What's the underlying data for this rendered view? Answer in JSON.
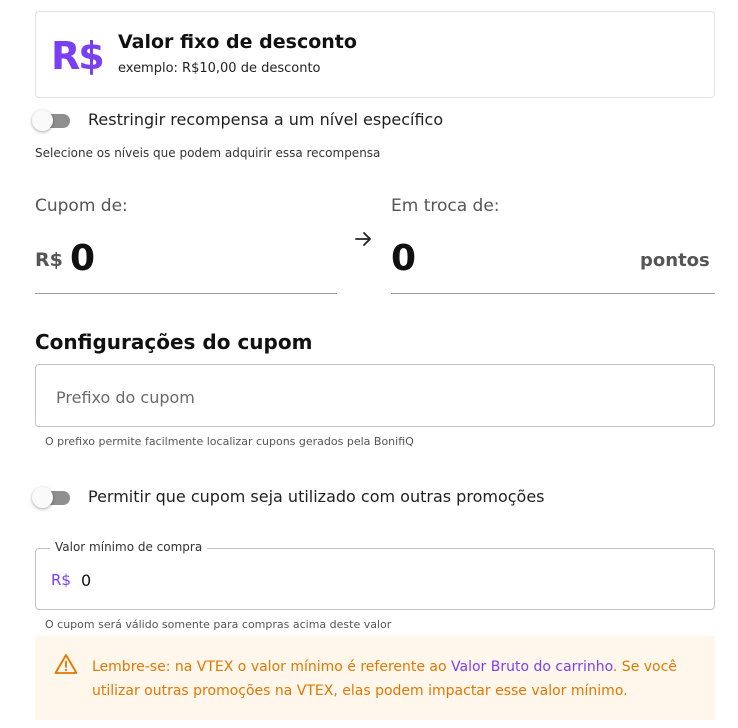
{
  "reward_type": {
    "currency_symbol": "R$",
    "title": "Valor fixo de desconto",
    "subtitle": "exemplo: R$10,00 de desconto"
  },
  "restrict_level": {
    "label": "Restringir recompensa a um nível específico",
    "enabled": false,
    "helper": "Selecione os níveis que podem adquirir essa recompensa"
  },
  "exchange": {
    "coupon_label": "Cupom de:",
    "coupon_prefix": "R$",
    "coupon_value": "0",
    "points_label": "Em troca de:",
    "points_value": "0",
    "points_suffix": "pontos",
    "arrow_icon": "arrow-right-icon"
  },
  "coupon_settings": {
    "title": "Configurações do cupom",
    "prefix_placeholder": "Prefixo do cupom",
    "prefix_value": "",
    "prefix_helper": "O prefixo permite facilmente localizar cupons gerados pela BonifiQ",
    "allow_promotions_label": "Permitir que cupom seja utilizado com outras promoções",
    "allow_promotions_enabled": false,
    "min_purchase_label": "Valor mínimo de compra",
    "min_purchase_currency": "R$",
    "min_purchase_value": "0",
    "min_purchase_helper": "O cupom será válido somente para compras acima deste valor"
  },
  "warning": {
    "icon": "warning-triangle-icon",
    "text_before": "Lembre-se: na VTEX o valor mínimo é referente ao ",
    "link_text": "Valor Bruto do carrinho",
    "text_after": ". Se você utilizar outras promoções na VTEX, elas podem impactar esse valor mínimo."
  },
  "colors": {
    "accent": "#7b3ff2",
    "warning_text": "#e07800",
    "warning_bg": "#fff6ec",
    "toggle_off": "#8f8f8f"
  }
}
